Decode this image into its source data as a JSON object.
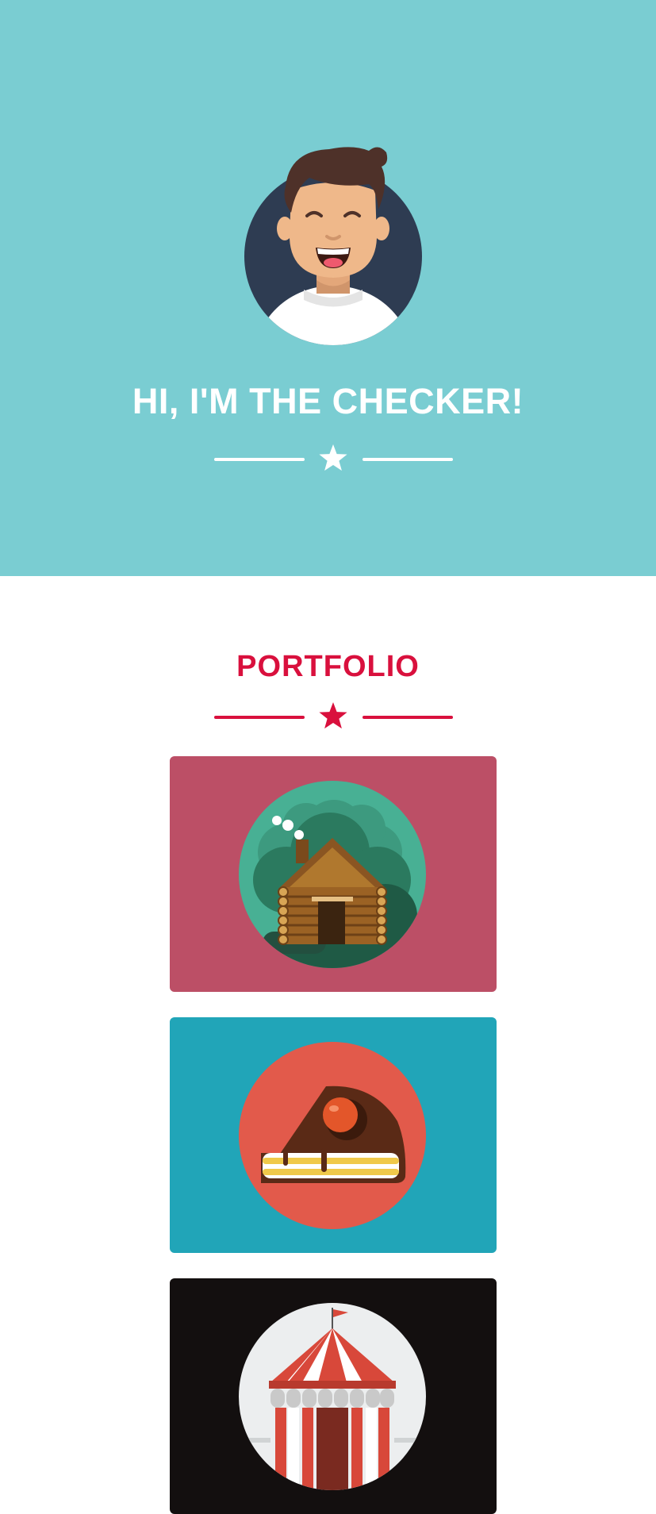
{
  "hero": {
    "title": "HI, I'M THE CHECKER!",
    "avatar_icon": "avatar-smiling-man",
    "divider_icon": "star-icon",
    "background": "#7acdd2",
    "text_color": "#ffffff"
  },
  "portfolio": {
    "title": "PORTFOLIO",
    "accent": "#d9103d",
    "divider_icon": "star-icon",
    "items": [
      {
        "icon": "log-cabin-icon",
        "background": "#bc4f66"
      },
      {
        "icon": "cake-slice-icon",
        "background": "#21a5b8"
      },
      {
        "icon": "circus-tent-icon",
        "background": "#130f0f"
      }
    ]
  }
}
